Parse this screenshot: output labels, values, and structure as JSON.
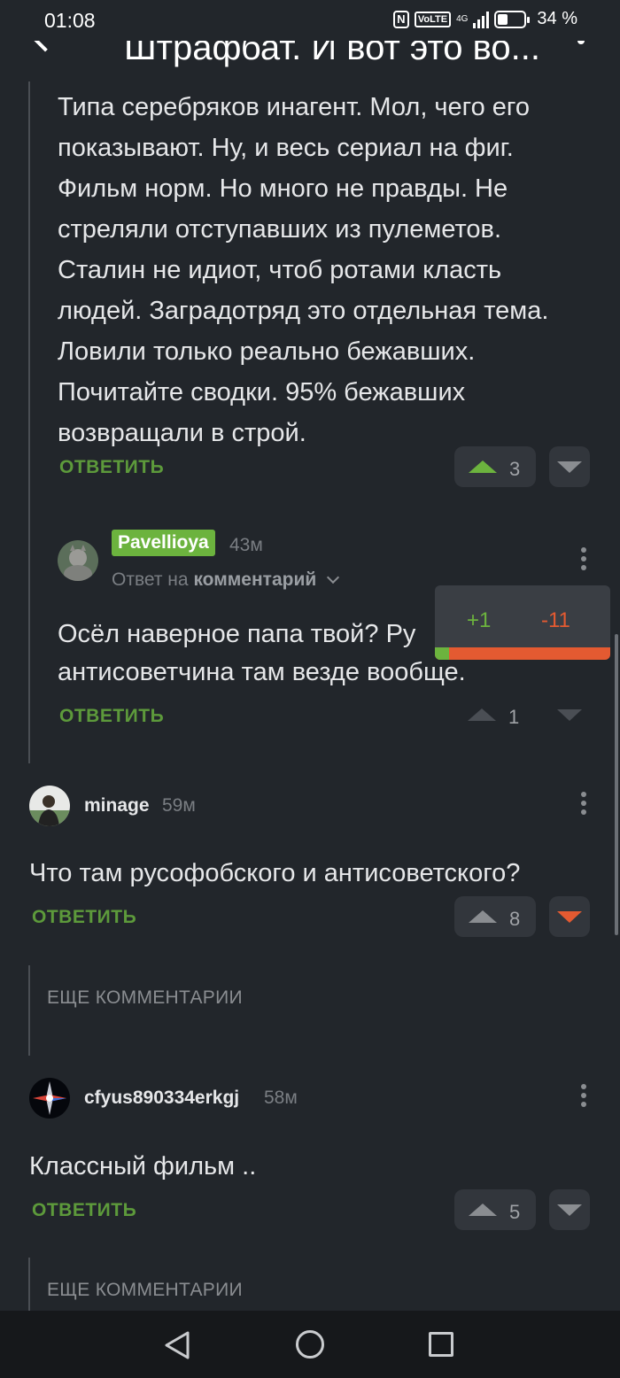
{
  "status_bar": {
    "time": "01:08",
    "nfc": "N",
    "volte": "VoLTE",
    "network": "4G",
    "battery": "34 %"
  },
  "header": {
    "title": "Штрафбат. И вот это во..."
  },
  "comments": [
    {
      "text_lines": [
        "Типа серебряков инагент. Мол, чего его",
        "показывают. Ну, и весь сериал на фиг.",
        "Фильм норм. Но много не правды. Не",
        "стреляли отступавших из пулеметов.",
        "Сталин не идиот, чтоб ротами класть",
        "людей. Заградотряд это отдельная тема.",
        "Ловили только реально бежавших.",
        "Почитайте сводки. 95% бежавших",
        "возвращали в строй."
      ],
      "reply_label": "ОТВЕТИТЬ",
      "rating": "3"
    },
    {
      "username": "Pavellioya",
      "time": "43м",
      "reply_to_prefix": "Ответ на",
      "reply_to_target": "комментарий",
      "text_lines": [
        "Осёл наверное папа твой? Ру",
        "антисоветчина там везде вообще."
      ],
      "reply_label": "ОТВЕТИТЬ",
      "rating": "1",
      "popup": {
        "plus": "+1",
        "minus": "-11",
        "positive_fraction": 0.083
      }
    },
    {
      "username": "minage",
      "time": "59м",
      "text": "Что там русофобского и антисоветского?",
      "reply_label": "ОТВЕТИТЬ",
      "rating": "8"
    },
    {
      "username": "cfyus890334erkgj",
      "time": "58м",
      "text": "Классный фильм ..",
      "reply_label": "ОТВЕТИТЬ",
      "rating": "5"
    }
  ],
  "more_comments": [
    "ЕЩЕ КОММЕНТАРИИ",
    "ЕЩЕ КОММЕНТАРИИ"
  ],
  "colors": {
    "background": "#22262b",
    "accent_green": "#5d9a3b",
    "upvote_green": "#6cb33e",
    "downvote_red": "#e45a31",
    "username_badge": "#6cb33e"
  },
  "icons": {
    "back": "back-arrow-icon",
    "menu": "more-vertical-icon",
    "nav_back": "nav-back-icon",
    "nav_home": "nav-home-icon",
    "nav_recent": "nav-recent-icon"
  }
}
